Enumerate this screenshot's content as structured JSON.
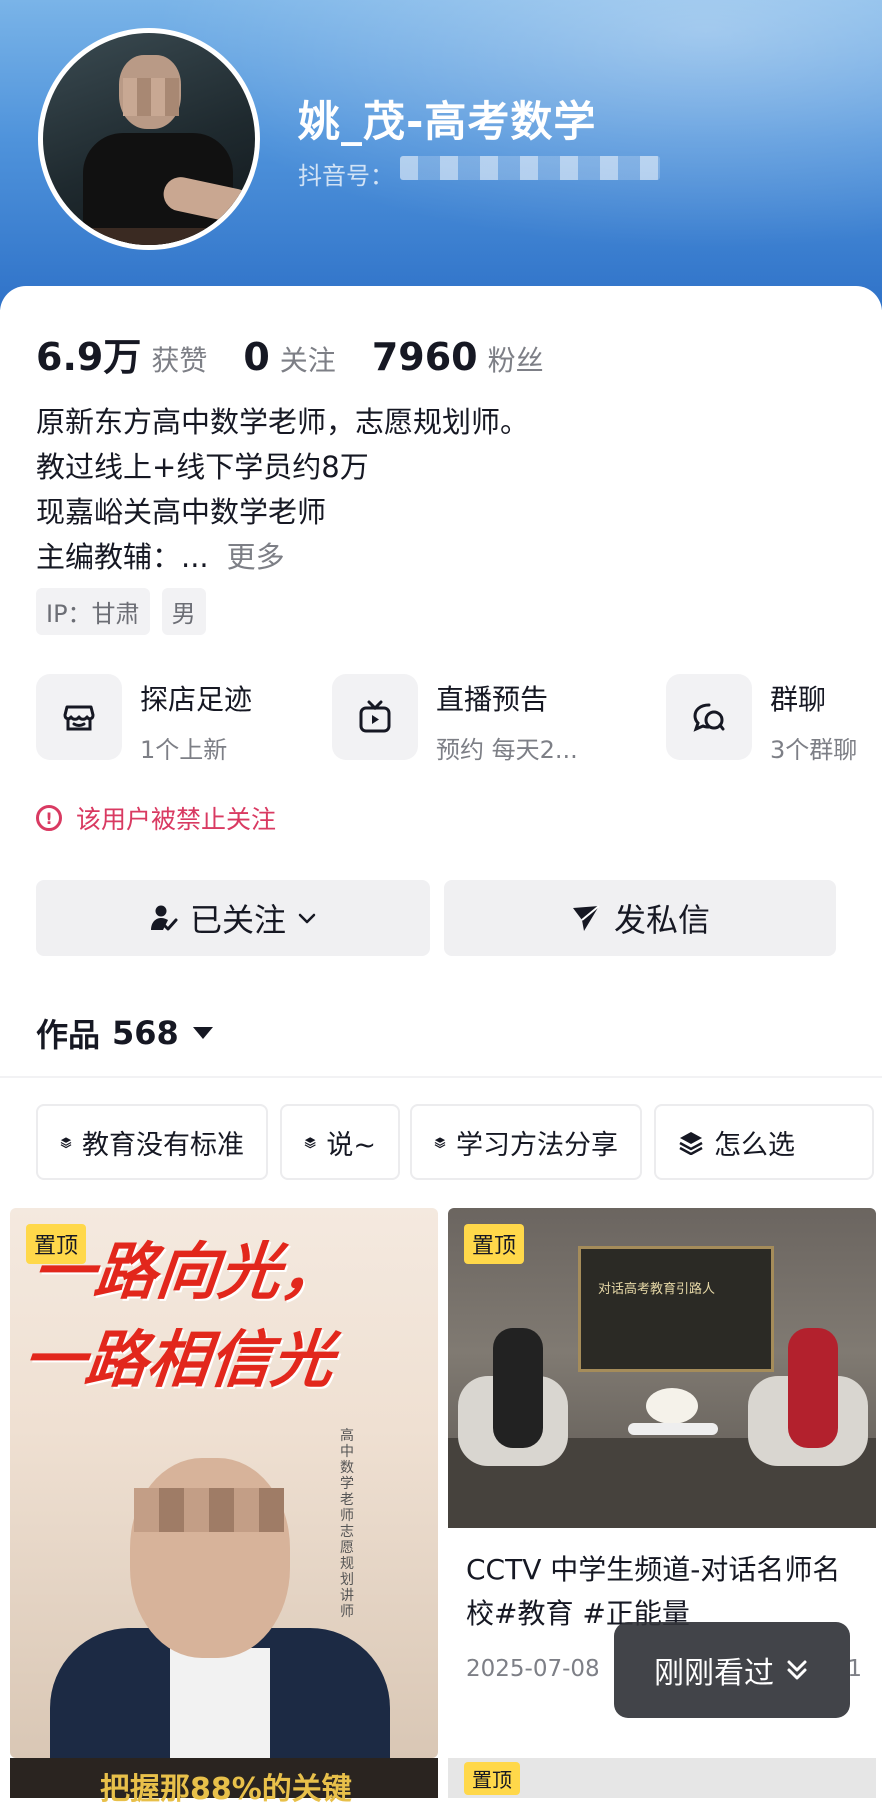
{
  "profile": {
    "name": "姚_茂-高考数学",
    "douyin_id_label": "抖音号："
  },
  "stats": {
    "likes_value": "6.9万",
    "likes_label": "获赞",
    "following_value": "0",
    "following_label": "关注",
    "followers_value": "7960",
    "followers_label": "粉丝"
  },
  "bio": {
    "line1": "原新东方高中数学老师，志愿规划师。",
    "line2": "教过线上+线下学员约8万",
    "line3": "现嘉峪关高中数学老师",
    "line4": "主编教辅：...",
    "more": "更多"
  },
  "tags": [
    "IP：甘肃",
    "男"
  ],
  "quicklinks": [
    {
      "title": "探店足迹",
      "sub": "1个上新",
      "icon": "shop-icon"
    },
    {
      "title": "直播预告",
      "sub": "预约 每天2...",
      "icon": "tv-icon"
    },
    {
      "title": "群聊",
      "sub": "3个群聊",
      "icon": "chat-icon"
    }
  ],
  "warning": {
    "text": "该用户被禁止关注",
    "color": "#d93a62"
  },
  "actions": {
    "follow_label": "已关注",
    "message_label": "发私信"
  },
  "works": {
    "label": "作品",
    "count": "568"
  },
  "collections": [
    "教育没有标准",
    "说~",
    "学习方法分享",
    "怎么选"
  ],
  "videos": [
    {
      "pinned": "置顶",
      "headline_line1": "一路向光，",
      "headline_line2": "一路相信光",
      "side_text": "高中数学老师 志愿规划讲师"
    },
    {
      "pinned": "置顶",
      "screen_text": "对话高考教育引路人",
      "title": "CCTV 中学生频道-对话名师名校#教育 #正能量",
      "date": "2025-07-08",
      "likes": "1"
    }
  ],
  "row2": {
    "left_text": "把握那88%的关键",
    "right_pin": "置顶"
  },
  "recent_button": {
    "label": "刚刚看过"
  }
}
